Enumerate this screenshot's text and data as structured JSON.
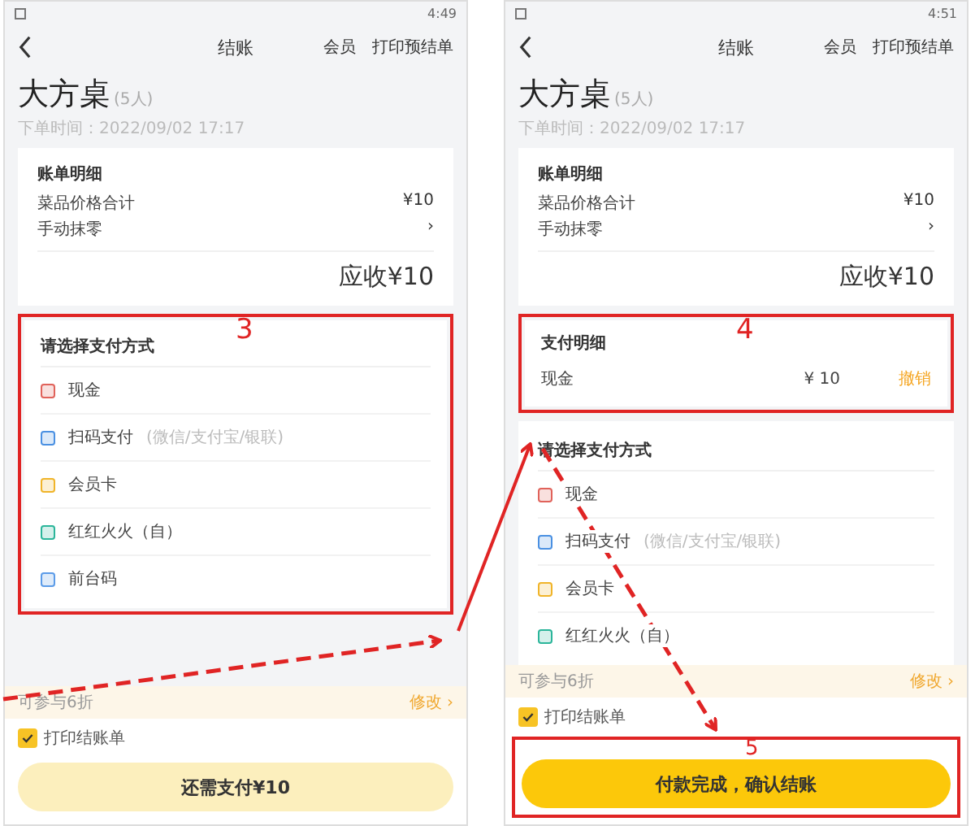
{
  "screens": [
    {
      "time": "4:49",
      "title": "结账",
      "header_links": [
        "会员",
        "打印预结单"
      ],
      "table_name": "大方桌",
      "guests": "(5人)",
      "order_time": "下单时间：2022/09/02 17:17",
      "bill": {
        "title": "账单明细",
        "rows": [
          {
            "label": "菜品价格合计",
            "value": "¥10"
          },
          {
            "label": "手动抹零",
            "value": "›"
          }
        ],
        "total": "应收¥10"
      },
      "methods": {
        "title": "请选择支付方式",
        "annotation": "3",
        "items": [
          {
            "label": "现金",
            "color": "#e0625a"
          },
          {
            "label": "扫码支付",
            "hint": "(微信/支付宝/银联)",
            "color": "#4a90e2"
          },
          {
            "label": "会员卡",
            "color": "#f0b429"
          },
          {
            "label": "红红火火（自）",
            "color": "#2bb59a"
          },
          {
            "label": "前台码",
            "color": "#5b9be8"
          }
        ]
      },
      "discount": {
        "text": "可参与6折",
        "action": "修改 ›"
      },
      "print_receipt": {
        "label": "打印结账单",
        "checked": true
      },
      "button": {
        "label": "还需支付¥10",
        "disabled": true
      }
    },
    {
      "time": "4:51",
      "title": "结账",
      "header_links": [
        "会员",
        "打印预结单"
      ],
      "table_name": "大方桌",
      "guests": "(5人)",
      "order_time": "下单时间：2022/09/02 17:17",
      "bill": {
        "title": "账单明细",
        "rows": [
          {
            "label": "菜品价格合计",
            "value": "¥10"
          },
          {
            "label": "手动抹零",
            "value": "›"
          }
        ],
        "total": "应收¥10"
      },
      "payment_details": {
        "title": "支付明细",
        "annotation": "4",
        "rows": [
          {
            "method": "现金",
            "amount": "¥ 10",
            "action": "撤销"
          }
        ]
      },
      "methods": {
        "title": "请选择支付方式",
        "items": [
          {
            "label": "现金",
            "color": "#e0625a"
          },
          {
            "label": "扫码支付",
            "hint": "(微信/支付宝/银联)",
            "color": "#4a90e2"
          },
          {
            "label": "会员卡",
            "color": "#f0b429"
          },
          {
            "label": "红红火火（自）",
            "color": "#2bb59a"
          }
        ]
      },
      "discount": {
        "text": "可参与6折",
        "action": "修改 ›"
      },
      "print_receipt": {
        "label": "打印结账单",
        "checked": true
      },
      "button": {
        "label": "付款完成，确认结账",
        "disabled": false,
        "annotation": "5"
      }
    }
  ]
}
